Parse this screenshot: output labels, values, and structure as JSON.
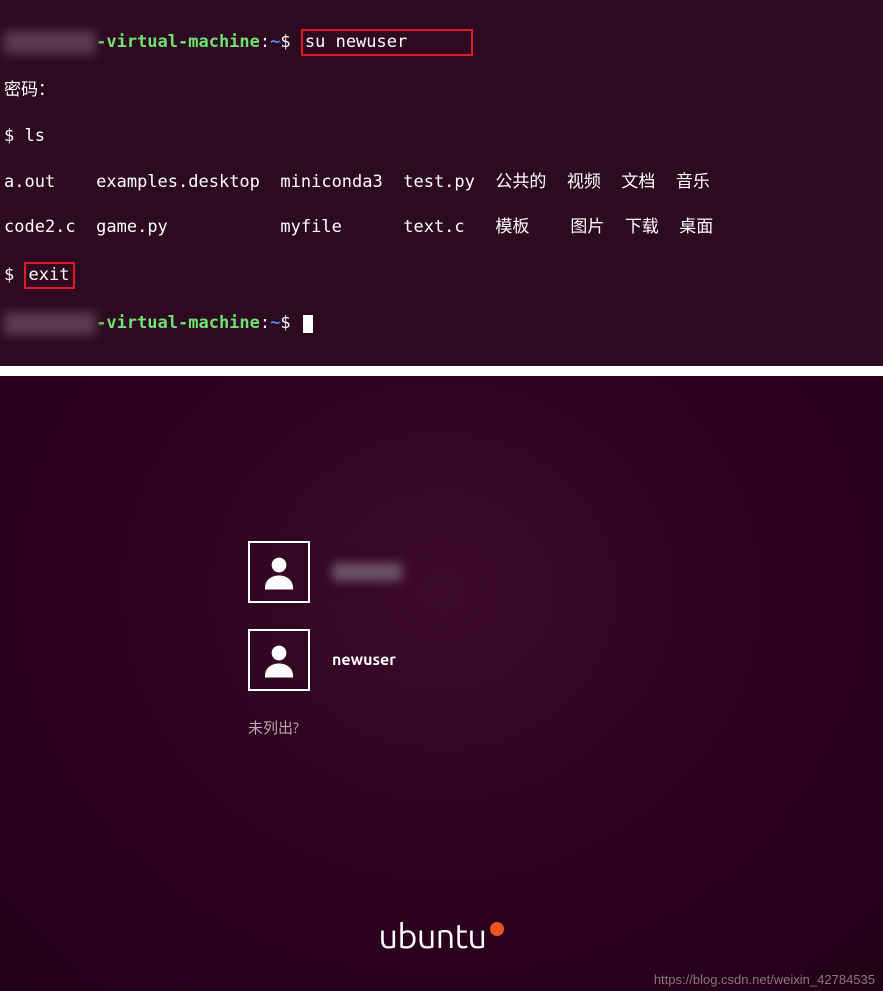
{
  "terminal": {
    "line1": {
      "user_blurred": "xxxxxxxxx",
      "host_suffix": "-virtual-machine",
      "path": "~",
      "command": "su newuser"
    },
    "password_prompt": "密码：",
    "shell_prompt": "$ ",
    "ls_cmd": "ls",
    "listing_row1": {
      "c1": "a.out",
      "c2": "examples.desktop",
      "c3": "miniconda3",
      "c4": "test.py",
      "c5": "公共的",
      "c6": "视频",
      "c7": "文档",
      "c8": "音乐"
    },
    "listing_row2": {
      "c1": "code2.c",
      "c2": "game.py",
      "c3": "myfile",
      "c4": "text.c",
      "c5": "模板",
      "c6": "图片",
      "c7": "下载",
      "c8": "桌面"
    },
    "exit_cmd": "exit",
    "line_last": {
      "user_blurred": "xxxxxxxxx",
      "host_suffix": "-virtual-machine",
      "path": "~"
    }
  },
  "login": {
    "user1_blurred": "xxxxxx",
    "user2": "newuser",
    "not_listed": "未列出?",
    "brand": "ubuntu"
  },
  "watermark": "https://blog.csdn.net/weixin_42784535"
}
